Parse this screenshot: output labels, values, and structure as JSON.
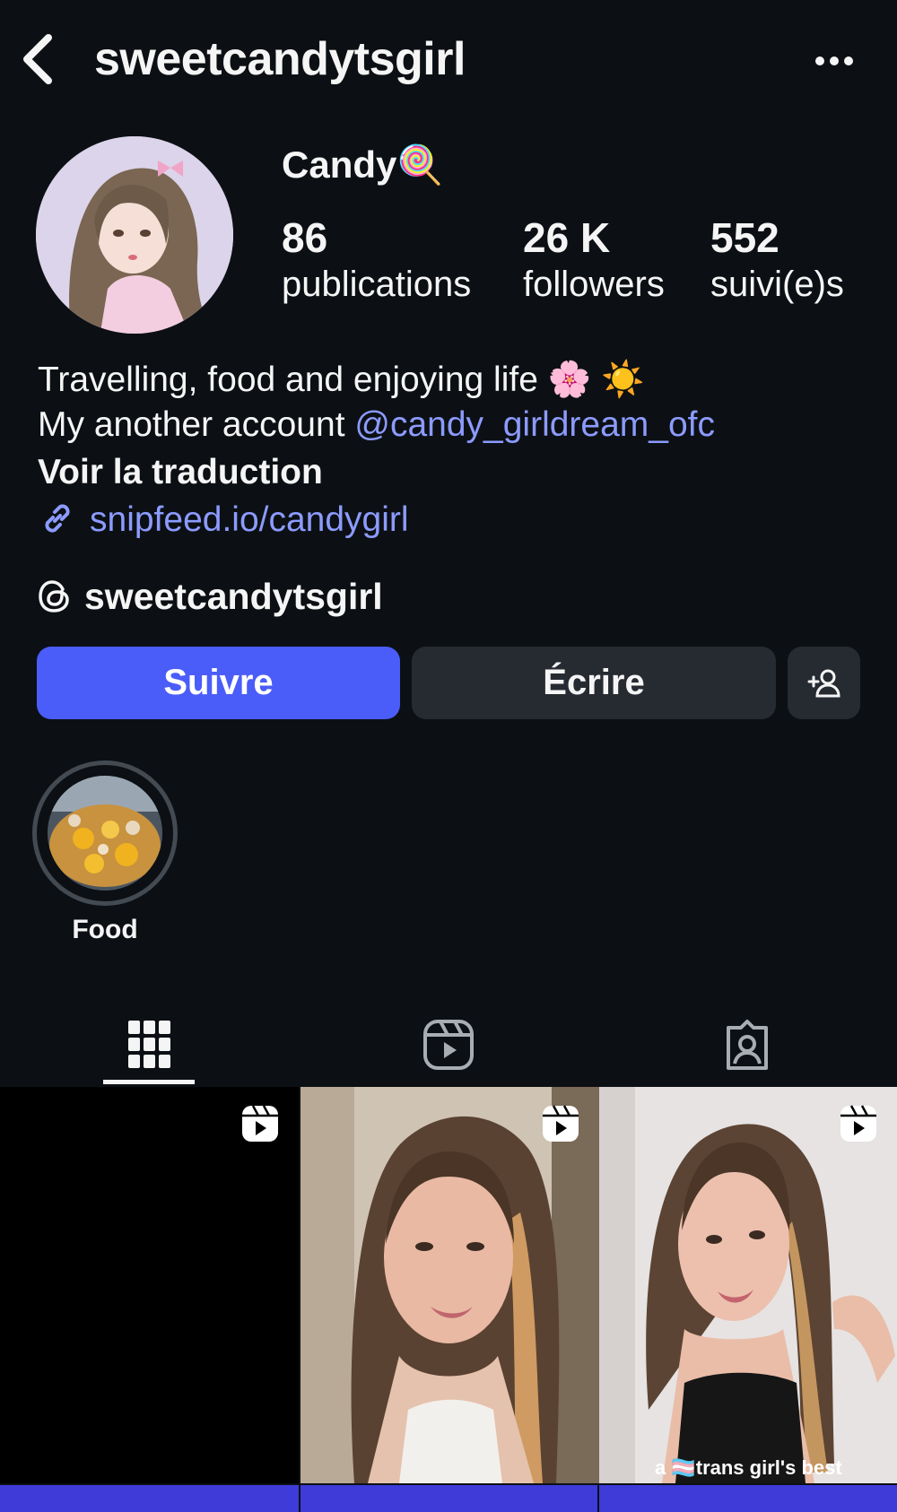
{
  "header": {
    "username": "sweetcandytsgirl",
    "back_icon": "chevron-left-icon",
    "more_icon": "more-horizontal-icon"
  },
  "profile": {
    "display_name": "Candy🍭",
    "stats": [
      {
        "value": "86",
        "label": "publications"
      },
      {
        "value": "26 K",
        "label": "followers"
      },
      {
        "value": "552",
        "label": "suivi(e)s"
      }
    ],
    "bio_line1": "Travelling, food and enjoying life 🌸 ☀️",
    "bio_line2_prefix": "My another account ",
    "bio_mention": "@candy_girldream_ofc",
    "translate_label": "Voir la traduction",
    "link": "snipfeed.io/candygirl",
    "threads_handle": "sweetcandytsgirl"
  },
  "actions": {
    "follow_label": "Suivre",
    "message_label": "Écrire",
    "add_user_icon": "add-person-icon"
  },
  "highlights": [
    {
      "label": "Food"
    }
  ],
  "tabs": [
    {
      "icon": "grid-icon",
      "active": true
    },
    {
      "icon": "reels-icon",
      "active": false
    },
    {
      "icon": "tagged-icon",
      "active": false
    }
  ],
  "posts": [
    {
      "type": "reel"
    },
    {
      "type": "reel"
    },
    {
      "type": "reel",
      "caption": "a 🏳️‍⚧️trans girl's best"
    }
  ],
  "colors": {
    "background": "#0c1014",
    "accent": "#4a5df9",
    "link": "#8c9bff",
    "secondary_button": "#262b32"
  }
}
